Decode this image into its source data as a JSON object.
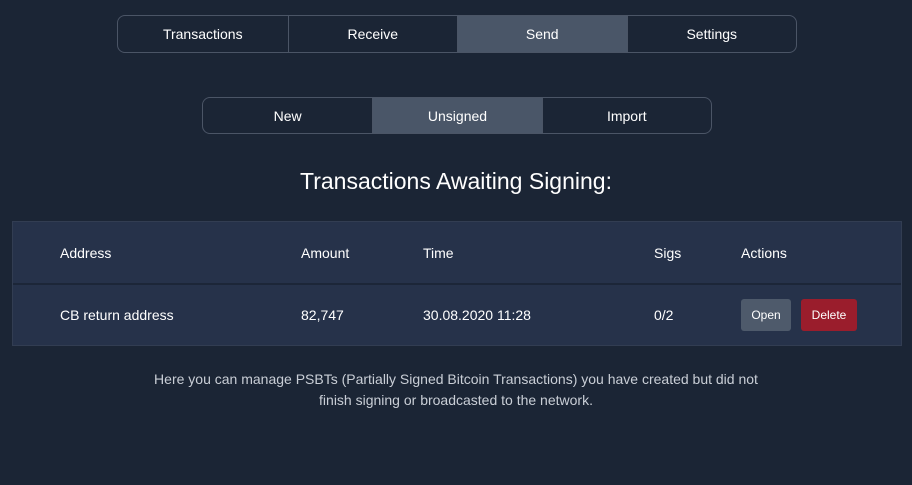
{
  "main_tabs": [
    {
      "label": "Transactions",
      "active": false
    },
    {
      "label": "Receive",
      "active": false
    },
    {
      "label": "Send",
      "active": true
    },
    {
      "label": "Settings",
      "active": false
    }
  ],
  "sub_tabs": [
    {
      "label": "New",
      "active": false
    },
    {
      "label": "Unsigned",
      "active": true
    },
    {
      "label": "Import",
      "active": false
    }
  ],
  "heading": "Transactions Awaiting Signing:",
  "table": {
    "columns": [
      "Address",
      "Amount",
      "Time",
      "Sigs",
      "Actions"
    ],
    "rows": [
      {
        "address": "CB return address",
        "amount": "82,747",
        "time": "30.08.2020 11:28",
        "sigs": "0/2",
        "open_label": "Open",
        "delete_label": "Delete"
      }
    ]
  },
  "note": "Here you can manage PSBTs (Partially Signed Bitcoin Transactions) you have created but did not finish signing or broadcasted to the network.",
  "colors": {
    "background": "#1b2535",
    "active_tab": "#4a5668",
    "table_bg": "#26324a",
    "delete_button": "#9a1d2c",
    "open_button": "#4e5a6b"
  }
}
